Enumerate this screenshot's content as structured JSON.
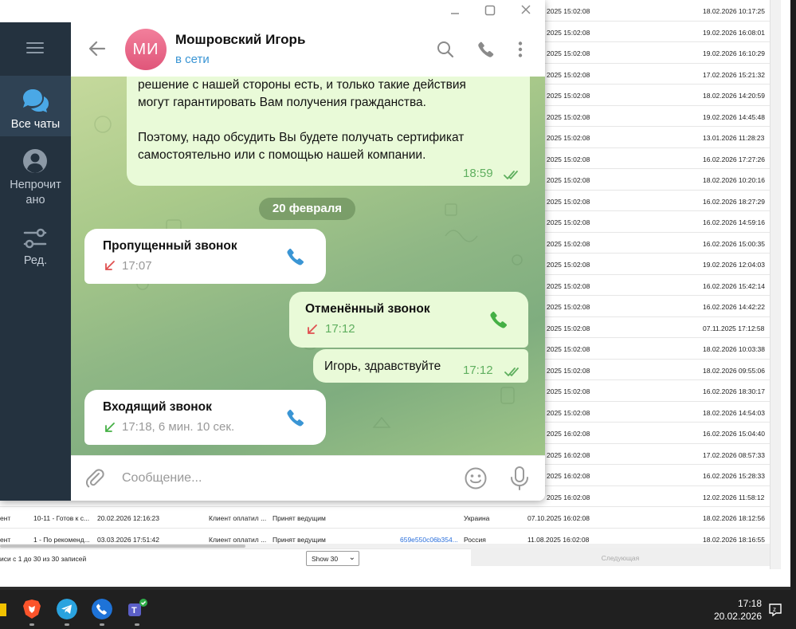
{
  "background_table": {
    "rows": [
      {
        "modified": "2025 15:02:08",
        "last": "18.02.2026 10:17:25"
      },
      {
        "modified": "2025 15:02:08",
        "last": "19.02.2026 16:08:01"
      },
      {
        "modified": "2025 15:02:08",
        "last": "19.02.2026 16:10:29"
      },
      {
        "modified": "2025 15:02:08",
        "last": "17.02.2026 15:21:32"
      },
      {
        "modified": "2025 15:02:08",
        "last": "18.02.2026 14:20:59"
      },
      {
        "modified": "2025 15:02:08",
        "last": "19.02.2026 14:45:48"
      },
      {
        "modified": "2025 15:02:08",
        "last": "13.01.2026 11:28:23"
      },
      {
        "modified": "2025 15:02:08",
        "last": "16.02.2026 17:27:26"
      },
      {
        "modified": "2025 15:02:08",
        "last": "18.02.2026 10:20:16"
      },
      {
        "modified": "2025 15:02:08",
        "last": "16.02.2026 18:27:29"
      },
      {
        "modified": "2025 15:02:08",
        "last": "16.02.2026 14:59:16"
      },
      {
        "modified": "2025 15:02:08",
        "last": "16.02.2026 15:00:35"
      },
      {
        "modified": "2025 15:02:08",
        "last": "19.02.2026 12:04:03"
      },
      {
        "modified": "2025 15:02:08",
        "last": "16.02.2026 15:42:14"
      },
      {
        "modified": "2025 15:02:08",
        "last": "16.02.2026 14:42:22"
      },
      {
        "modified": "2025 15:02:08",
        "last": "07.11.2025 17:12:58"
      },
      {
        "modified": "2025 15:02:08",
        "last": "18.02.2026 10:03:38"
      },
      {
        "modified": "2025 15:02:08",
        "last": "18.02.2026 09:55:06"
      },
      {
        "modified": "2025 15:02:08",
        "last": "16.02.2026 18:30:17"
      },
      {
        "modified": "2025 15:02:08",
        "last": "18.02.2026 14:54:03"
      },
      {
        "modified": "2025 16:02:08",
        "last": "16.02.2026 15:04:40"
      },
      {
        "modified": "2025 16:02:08",
        "last": "17.02.2026 08:57:33"
      },
      {
        "modified": "2025 16:02:08",
        "last": "16.02.2026 15:28:33"
      },
      {
        "modified": "2025 16:02:08",
        "last": "12.02.2026 11:58:12"
      }
    ],
    "bottom_rows": [
      [
        "ент",
        "10-11 - Готов к с...",
        "20.02.2026 12:16:23",
        "Клиент оплатил ...",
        "Принят ведущим",
        "",
        "Украина",
        "07.10.2025 16:02:08",
        "18.02.2026 18:12:56"
      ],
      [
        "ент",
        "1 - По рекоменд...",
        "03.03.2026 17:51:42",
        "Клиент оплатил ...",
        "Принят ведущим",
        "659e550c06b354...",
        "Россия",
        "11.08.2025 16:02:08",
        "18.02.2026 18:16:55"
      ]
    ],
    "records_info": "иси с 1 до 30 из 30 записей",
    "show_select": "Show 30",
    "next_button": "Следующая"
  },
  "sidebar": {
    "folders": [
      {
        "label_lines": [
          "Все чаты"
        ],
        "icon": "chats-icon",
        "active": true
      },
      {
        "label_lines": [
          "Непрочит",
          "ано"
        ],
        "icon": "person-icon",
        "active": false
      },
      {
        "label_lines": [
          "Ред."
        ],
        "icon": "sliders-icon",
        "active": false
      }
    ]
  },
  "header": {
    "avatar_initials": "МИ",
    "peer_name": "Мошровский Игорь",
    "status": "в сети"
  },
  "chat": {
    "top_message": {
      "lines": [
        "решение с нашей стороны есть, и только такие действия",
        "могут гарантировать Вам получения гражданства.",
        "",
        "Поэтому, надо обсудить Вы будете получать сертификат",
        "самостоятельно или с помощью нашей компании."
      ],
      "time": "18:59"
    },
    "date_separator": "20 февраля",
    "missed_call": {
      "title": "Пропущенный звонок",
      "time": "17:07"
    },
    "cancelled_call": {
      "title": "Отменённый звонок",
      "time": "17:12"
    },
    "greeting": {
      "text": "Игорь, здравствуйте",
      "time": "17:12"
    },
    "incoming_call": {
      "title": "Входящий звонок",
      "time": "17:18, 6 мин. 10 сек."
    }
  },
  "composer": {
    "placeholder": "Сообщение..."
  },
  "taskbar": {
    "time": "17:18",
    "date": "20.02.2026"
  },
  "colors": {
    "sidebar_bg": "#24323f",
    "accent": "#3a95d4",
    "outgoing_bubble": "#e9fad8",
    "read_check": "#5faf5f",
    "missed_red": "#e05050"
  }
}
